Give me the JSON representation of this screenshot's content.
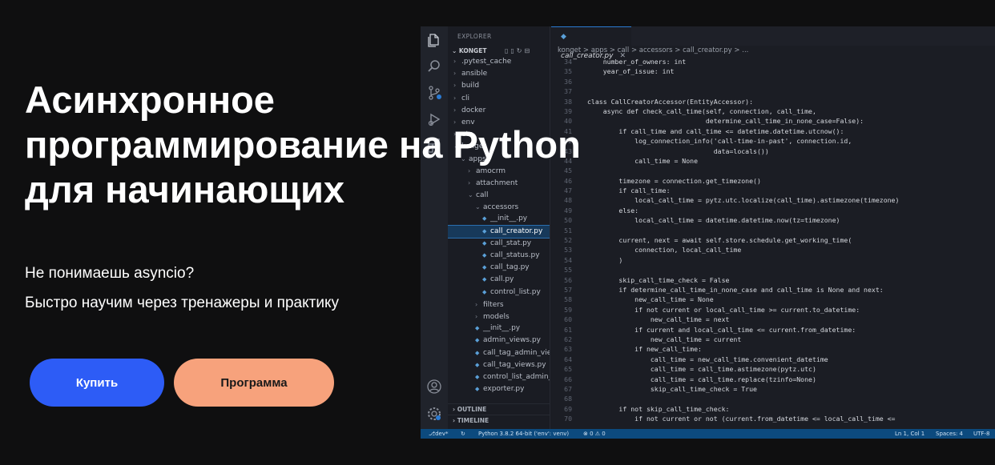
{
  "hero": {
    "title_lines": [
      "Асинхронное",
      "программирование на Python",
      "для начинающих"
    ],
    "subtitle_lines": [
      "Не понимаешь asyncio?",
      "Быстро научим через тренажеры и практику"
    ],
    "buy_label": "Купить",
    "program_label": "Программа"
  },
  "colors": {
    "background": "#0f0f10",
    "buy_button": "#2d5cf6",
    "program_button": "#f7a27c",
    "status_bar": "#0c4a7e"
  },
  "editor": {
    "explorer_title": "EXPLORER",
    "root_folder": "KONGET",
    "active_tab": "call_creator.py",
    "tab_close": "✕",
    "breadcrumb": "konget > apps > call > accessors > call_creator.py > ...",
    "activity_icons": [
      "files-icon",
      "search-icon",
      "source-control-icon",
      "run-debug-icon",
      "extensions-icon",
      "account-icon",
      "gear-icon"
    ],
    "tree": [
      {
        "name": ".pytest_cache",
        "kind": "folder",
        "depth": 1
      },
      {
        "name": "ansible",
        "kind": "folder",
        "depth": 1
      },
      {
        "name": "build",
        "kind": "folder",
        "depth": 1
      },
      {
        "name": "cli",
        "kind": "folder",
        "depth": 1
      },
      {
        "name": "docker",
        "kind": "folder",
        "depth": 1
      },
      {
        "name": "env",
        "kind": "folder",
        "depth": 1
      },
      {
        "name": "etc",
        "kind": "folder",
        "depth": 1
      },
      {
        "name": "konget",
        "kind": "folder",
        "depth": 1,
        "open": true
      },
      {
        "name": "apps",
        "kind": "folder",
        "depth": 2,
        "open": true
      },
      {
        "name": "amocrm",
        "kind": "folder",
        "depth": 3
      },
      {
        "name": "attachment",
        "kind": "folder",
        "depth": 3
      },
      {
        "name": "call",
        "kind": "folder",
        "depth": 3,
        "open": true
      },
      {
        "name": "accessors",
        "kind": "folder",
        "depth": 4,
        "open": true
      },
      {
        "name": "__init__.py",
        "kind": "file",
        "depth": 5
      },
      {
        "name": "call_creator.py",
        "kind": "file",
        "depth": 5,
        "selected": true
      },
      {
        "name": "call_stat.py",
        "kind": "file",
        "depth": 5
      },
      {
        "name": "call_status.py",
        "kind": "file",
        "depth": 5
      },
      {
        "name": "call_tag.py",
        "kind": "file",
        "depth": 5
      },
      {
        "name": "call.py",
        "kind": "file",
        "depth": 5
      },
      {
        "name": "control_list.py",
        "kind": "file",
        "depth": 5
      },
      {
        "name": "filters",
        "kind": "folder",
        "depth": 4
      },
      {
        "name": "models",
        "kind": "folder",
        "depth": 4
      },
      {
        "name": "__init__.py",
        "kind": "file",
        "depth": 4
      },
      {
        "name": "admin_views.py",
        "kind": "file",
        "depth": 4
      },
      {
        "name": "call_tag_admin_vie...",
        "kind": "file",
        "depth": 4
      },
      {
        "name": "call_tag_views.py",
        "kind": "file",
        "depth": 4
      },
      {
        "name": "control_list_admin_...",
        "kind": "file",
        "depth": 4
      },
      {
        "name": "exporter.py",
        "kind": "file",
        "depth": 4
      }
    ],
    "outline_label": "OUTLINE",
    "timeline_label": "TIMELINE",
    "code_lines": [
      {
        "n": "34",
        "t": "    number_of_owners: int"
      },
      {
        "n": "35",
        "t": "    year_of_issue: int"
      },
      {
        "n": "36",
        "t": ""
      },
      {
        "n": "37",
        "t": ""
      },
      {
        "n": "38",
        "t": "class CallCreatorAccessor(EntityAccessor):"
      },
      {
        "n": "39",
        "t": "    async def check_call_time(self, connection, call_time,"
      },
      {
        "n": "40",
        "t": "                              determine_call_time_in_none_case=False):"
      },
      {
        "n": "41",
        "t": "        if call_time and call_time <= datetime.datetime.utcnow():"
      },
      {
        "n": "42",
        "t": "            log_connection_info('call-time-in-past', connection.id,"
      },
      {
        "n": "43",
        "t": "                                data=locals())"
      },
      {
        "n": "44",
        "t": "            call_time = None"
      },
      {
        "n": "45",
        "t": ""
      },
      {
        "n": "46",
        "t": "        timezone = connection.get_timezone()"
      },
      {
        "n": "47",
        "t": "        if call_time:"
      },
      {
        "n": "48",
        "t": "            local_call_time = pytz.utc.localize(call_time).astimezone(timezone)"
      },
      {
        "n": "49",
        "t": "        else:"
      },
      {
        "n": "50",
        "t": "            local_call_time = datetime.datetime.now(tz=timezone)"
      },
      {
        "n": "51",
        "t": ""
      },
      {
        "n": "52",
        "t": "        current, next = await self.store.schedule.get_working_time("
      },
      {
        "n": "53",
        "t": "            connection, local_call_time"
      },
      {
        "n": "54",
        "t": "        )"
      },
      {
        "n": "55",
        "t": ""
      },
      {
        "n": "56",
        "t": "        skip_call_time_check = False"
      },
      {
        "n": "57",
        "t": "        if determine_call_time_in_none_case and call_time is None and next:"
      },
      {
        "n": "58",
        "t": "            new_call_time = None"
      },
      {
        "n": "59",
        "t": "            if not current or local_call_time >= current.to_datetime:"
      },
      {
        "n": "60",
        "t": "                new_call_time = next"
      },
      {
        "n": "61",
        "t": "            if current and local_call_time <= current.from_datetime:"
      },
      {
        "n": "62",
        "t": "                new_call_time = current"
      },
      {
        "n": "63",
        "t": "            if new_call_time:"
      },
      {
        "n": "64",
        "t": "                call_time = new_call_time.convenient_datetime"
      },
      {
        "n": "65",
        "t": "                call_time = call_time.astimezone(pytz.utc)"
      },
      {
        "n": "66",
        "t": "                call_time = call_time.replace(tzinfo=None)"
      },
      {
        "n": "67",
        "t": "                skip_call_time_check = True"
      },
      {
        "n": "68",
        "t": ""
      },
      {
        "n": "69",
        "t": "        if not skip_call_time_check:"
      },
      {
        "n": "70",
        "t": "            if not current or not (current.from_datetime <= local_call_time <="
      }
    ],
    "status": {
      "branch": "dev*",
      "interpreter": "Python 3.8.2 64-bit ('env': venv)",
      "problems": "⊗ 0 ⚠ 0",
      "position": "Ln 1, Col 1",
      "spaces": "Spaces: 4",
      "encoding": "UTF-8"
    }
  }
}
